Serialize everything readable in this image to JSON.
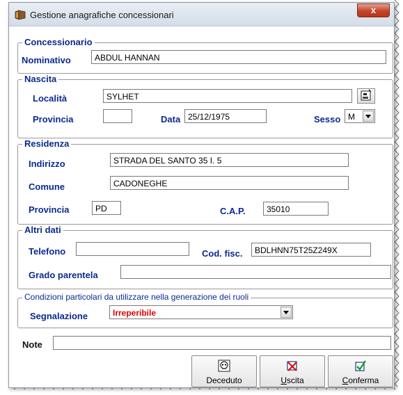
{
  "window": {
    "title": "Gestione anagrafiche concessionari",
    "close_glyph": "x",
    "title_icon": "folder-stack-icon"
  },
  "concessionario": {
    "legend": "Concessionario",
    "nominativo_label": "Nominativo",
    "nominativo_value": "ABDUL HANNAN"
  },
  "nascita": {
    "legend": "Nascita",
    "localita_label": "Località",
    "localita_value": "SYLHET",
    "provincia_label": "Provincia",
    "provincia_value": "",
    "data_label": "Data",
    "data_value": "25/12/1975",
    "sesso_label": "Sesso",
    "sesso_value": "M"
  },
  "residenza": {
    "legend": "Residenza",
    "indirizzo_label": "Indirizzo",
    "indirizzo_value": "STRADA DEL SANTO 35 I. 5",
    "comune_label": "Comune",
    "comune_value": "CADONEGHE",
    "provincia_label": "Provincia",
    "provincia_value": "PD",
    "cap_label": "C.A.P.",
    "cap_value": "35010"
  },
  "altri_dati": {
    "legend": "Altri dati",
    "telefono_label": "Telefono",
    "telefono_value": "",
    "codfisc_label": "Cod. fisc.",
    "codfisc_value": "BDLHNN75T25Z249X",
    "grado_label": "Grado parentela",
    "grado_value": ""
  },
  "condizioni": {
    "legend": "Condizioni particolari  da utilizzare nella generazione dei ruoli",
    "segnalazione_label": "Segnalazione",
    "segnalazione_value": "Irreperibile",
    "segnalazione_color": "#e00000"
  },
  "note": {
    "label": "Note",
    "value": ""
  },
  "buttons": {
    "deceduto": "Deceduto",
    "uscita": "Uscita",
    "conferma": "Conferma"
  },
  "colors": {
    "label_blue": "#0b2a8f",
    "value_red": "#e00000"
  }
}
